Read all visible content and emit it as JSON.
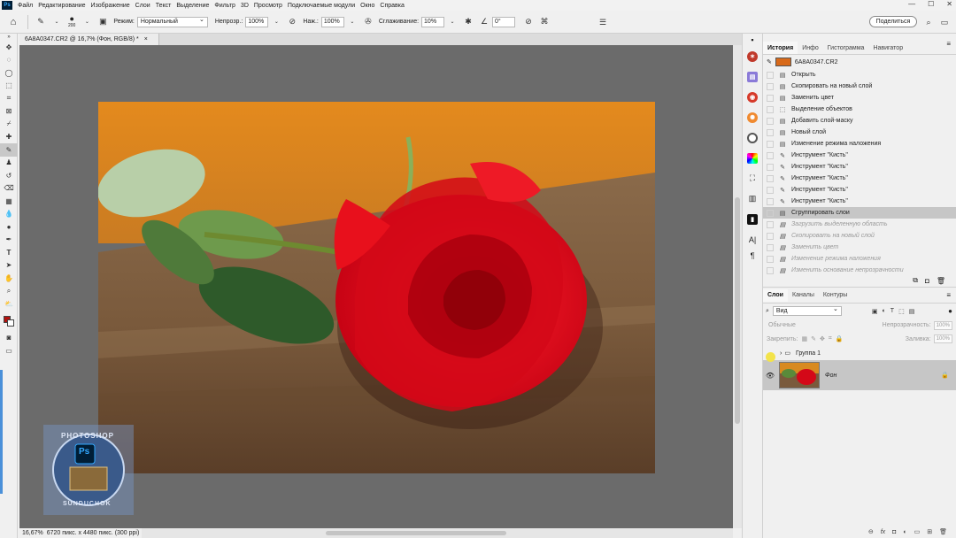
{
  "menu": {
    "logo": "Ps",
    "items": [
      "Файл",
      "Редактирование",
      "Изображение",
      "Слои",
      "Текст",
      "Выделение",
      "Фильтр",
      "3D",
      "Просмотр",
      "Подключаемые модули",
      "Окно",
      "Справка"
    ],
    "window_controls": [
      "—",
      "☐",
      "✕"
    ]
  },
  "options": {
    "brush_size": "200",
    "mode_label": "Режим:",
    "mode_value": "Нормальный",
    "opacity_label": "Непрозр.:",
    "opacity_value": "100%",
    "pressure_label": "Наж.:",
    "pressure_value": "100%",
    "smoothing_label": "Сглаживание:",
    "smoothing_value": "10%",
    "angle_value": "0°",
    "share_label": "Поделиться"
  },
  "document": {
    "tab_title": "6A8A0347.CR2 @ 16,7% (Фон, RGB/8) *",
    "close": "×"
  },
  "status": {
    "zoom": "16,67%",
    "size": "6720 пикс. x 4480 пикс. (300 ppi)"
  },
  "history": {
    "tabs": [
      "История",
      "Инфо",
      "Гистограмма",
      "Навигатор"
    ],
    "snapshot_name": "6A8A0347.CR2",
    "items": [
      {
        "label": "Открыть",
        "icon": "doc",
        "state": "done"
      },
      {
        "label": "Скопировать на новый слой",
        "icon": "doc",
        "state": "done"
      },
      {
        "label": "Заменить цвет",
        "icon": "doc",
        "state": "done"
      },
      {
        "label": "Выделение объектов",
        "icon": "select",
        "state": "done"
      },
      {
        "label": "Добавить слой-маску",
        "icon": "doc",
        "state": "done"
      },
      {
        "label": "Новый слой",
        "icon": "doc",
        "state": "done"
      },
      {
        "label": "Изменение режима наложения",
        "icon": "doc",
        "state": "done"
      },
      {
        "label": "Инструмент \"Кисть\"",
        "icon": "brush",
        "state": "done"
      },
      {
        "label": "Инструмент \"Кисть\"",
        "icon": "brush",
        "state": "done"
      },
      {
        "label": "Инструмент \"Кисть\"",
        "icon": "brush",
        "state": "done"
      },
      {
        "label": "Инструмент \"Кисть\"",
        "icon": "brush",
        "state": "done"
      },
      {
        "label": "Инструмент \"Кисть\"",
        "icon": "brush",
        "state": "done"
      },
      {
        "label": "Сгруппировать слои",
        "icon": "doc",
        "state": "current"
      },
      {
        "label": "Загрузить выделенную область",
        "icon": "doc",
        "state": "undone"
      },
      {
        "label": "Скопировать на новый слой",
        "icon": "doc",
        "state": "undone"
      },
      {
        "label": "Заменить цвет",
        "icon": "doc",
        "state": "undone"
      },
      {
        "label": "Изменение режима наложения",
        "icon": "doc",
        "state": "undone"
      },
      {
        "label": "Изменить основание непрозрачности",
        "icon": "doc",
        "state": "undone"
      }
    ]
  },
  "layers": {
    "tabs": [
      "Слои",
      "Каналы",
      "Контуры"
    ],
    "kind_filter": "Вид",
    "blend_mode": "Обычные",
    "opacity_label": "Непрозрачность:",
    "opacity_value": "100%",
    "lock_label": "Закрепить:",
    "fill_label": "Заливка:",
    "fill_value": "100%",
    "group_name": "Группа 1",
    "background_name": "Фон"
  },
  "watermark": {
    "top_text": "PHOTOSHOP",
    "bottom_text": "SUNDUCHOK",
    "badge": "Ps"
  },
  "colors": {
    "foreground": "#b3120e",
    "background": "#ffffff",
    "canvas_bg": "#6b6b6b"
  }
}
